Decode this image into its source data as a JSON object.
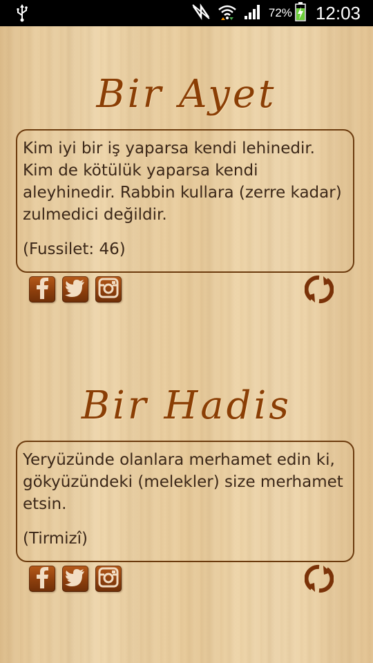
{
  "status_bar": {
    "battery_percent": "72%",
    "time": "12:03",
    "icons": [
      "usb-icon",
      "nfc-icon",
      "wifi-icon",
      "signal-icon",
      "battery-charging-icon"
    ]
  },
  "ayet": {
    "title": "Bir Ayet",
    "text": "Kim iyi bir iş yaparsa kendi lehinedir. Kim de kötülük yaparsa kendi aleyhinedir. Rabbin kullara (zerre kadar) zulmedici değildir.",
    "source": "(Fussilet: 46)"
  },
  "hadis": {
    "title": "Bir Hadis",
    "text": "Yeryüzünde olanlara merhamet edin ki, gökyüzündeki (melekler) size merhamet etsin.",
    "source": "(Tirmizî)"
  },
  "share_icons": [
    "facebook-icon",
    "twitter-icon",
    "instagram-icon"
  ],
  "colors": {
    "title": "#8a3e05",
    "border": "#6b3a0d",
    "text": "#3b2718",
    "icon_bg": "#8d3f0d"
  }
}
